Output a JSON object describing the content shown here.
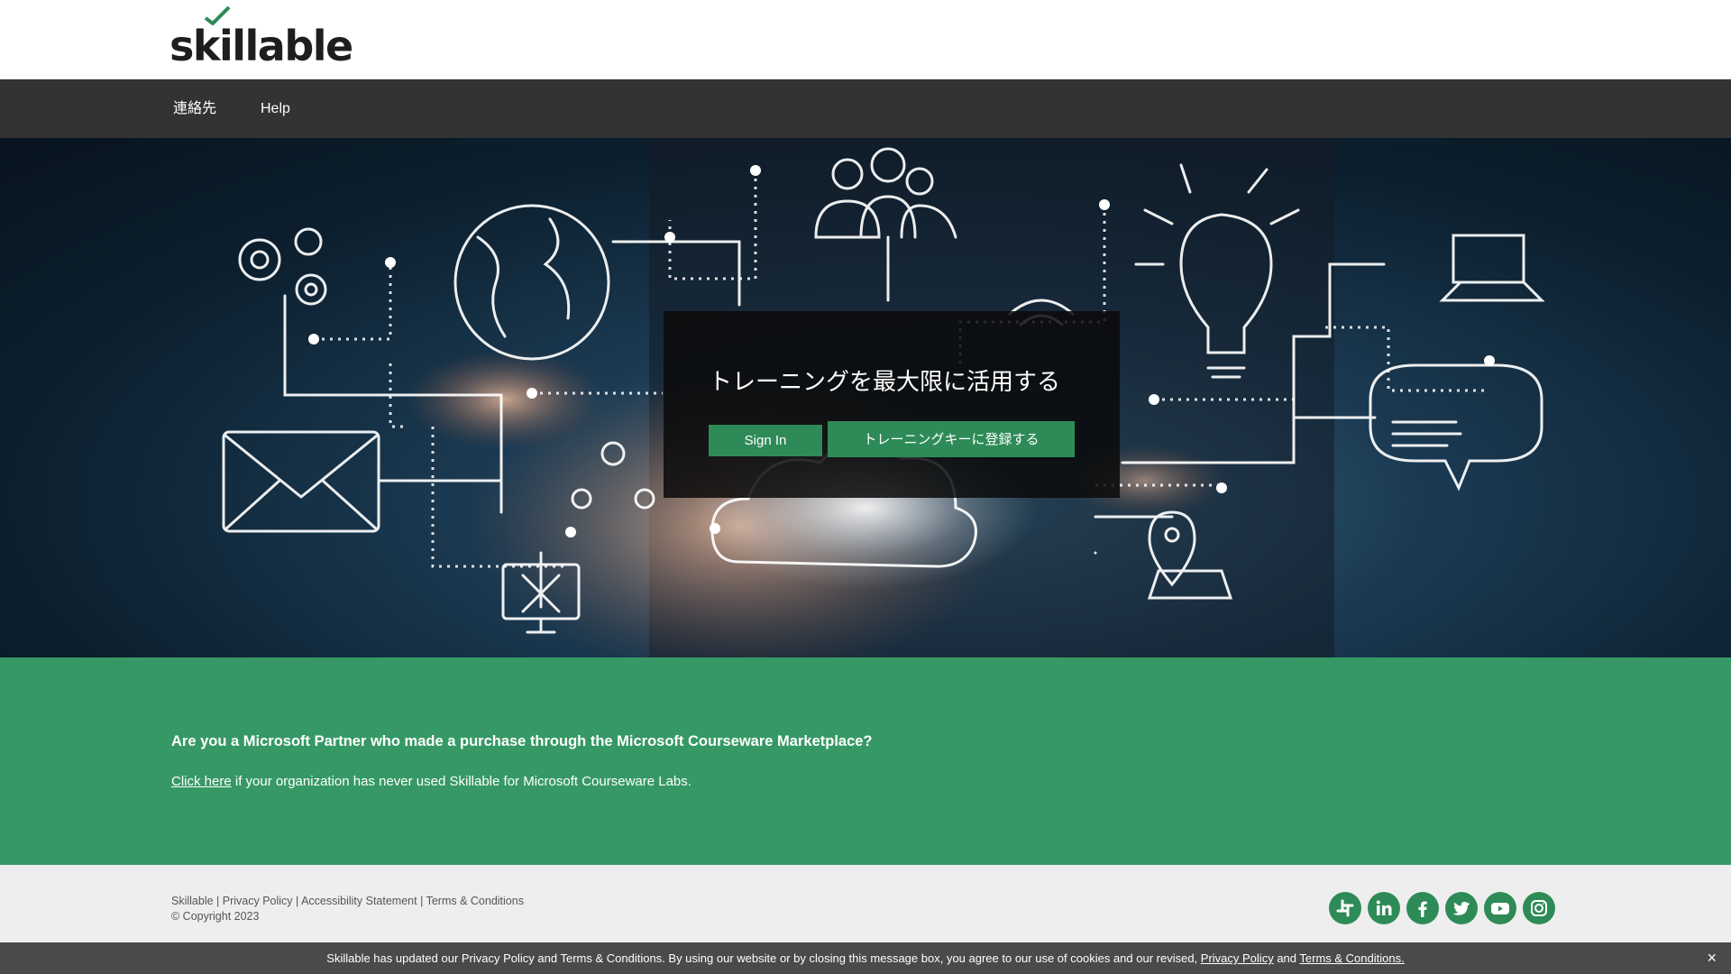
{
  "header": {
    "logo_text": "skillable"
  },
  "nav": {
    "items": [
      {
        "label": "連絡先"
      },
      {
        "label": "Help"
      }
    ]
  },
  "hero": {
    "title": "トレーニングを最大限に活用する",
    "sign_in_label": "Sign In",
    "register_label": "トレーニングキーに登録する"
  },
  "partner": {
    "question": "Are you a Microsoft Partner who made a purchase through the Microsoft Courseware Marketplace?",
    "link_text": "Click here",
    "line_rest": " if your organization has never used Skillable for Microsoft Courseware Labs."
  },
  "footer": {
    "links": [
      "Skillable",
      "Privacy Policy",
      "Accessibility Statement",
      "Terms & Conditions"
    ],
    "separator": " | ",
    "copyright": "© Copyright 2023",
    "socials": [
      "slack-icon",
      "linkedin-icon",
      "facebook-icon",
      "twitter-icon",
      "youtube-icon",
      "instagram-icon"
    ]
  },
  "cookie": {
    "message": "Skillable has updated our Privacy Policy and Terms & Conditions. By using our website or by closing this message box, you agree to our use of cookies and our revised, ",
    "privacy_link": "Privacy Policy",
    "and_text": " and ",
    "terms_link": "Terms & Conditions.",
    "close_symbol": "×"
  },
  "colors": {
    "brand_green": "#369965",
    "button_green": "#2e8b57",
    "nav_bg": "#333333",
    "cookie_bg": "#4a4a4a"
  }
}
